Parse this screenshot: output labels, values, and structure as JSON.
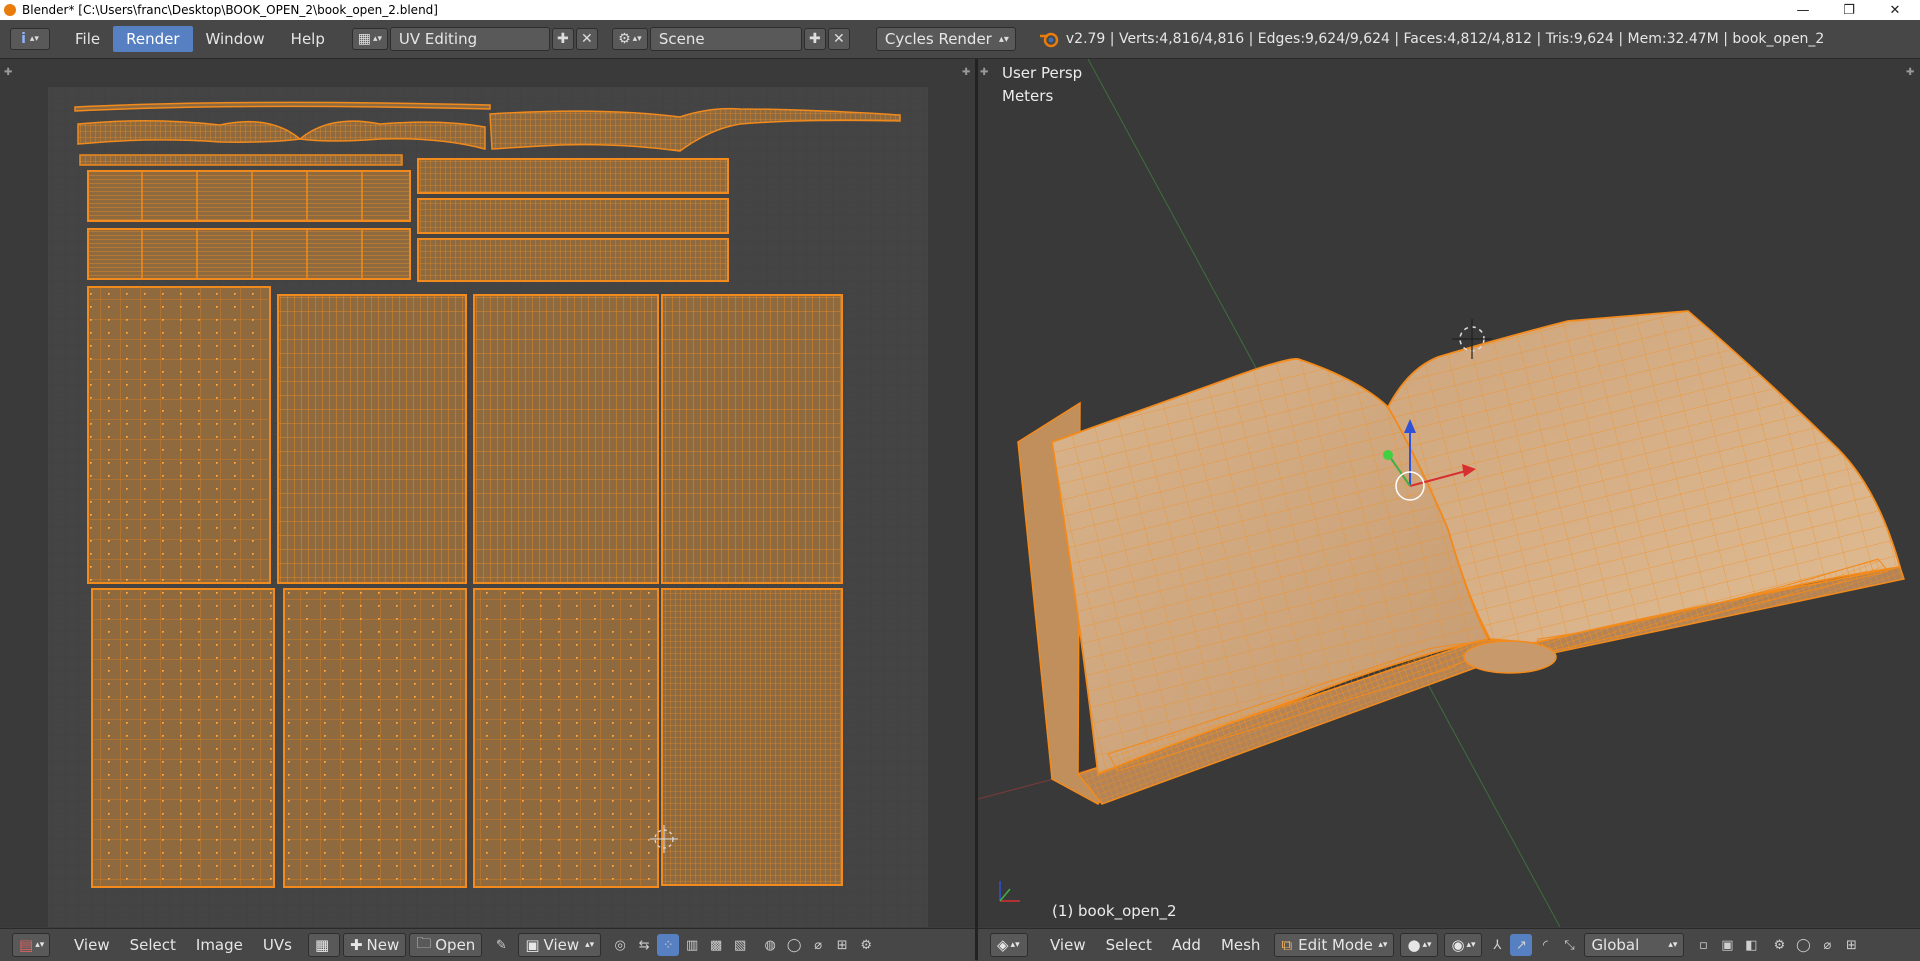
{
  "titlebar": {
    "title": "Blender* [C:\\Users\\franc\\Desktop\\BOOK_OPEN_2\\book_open_2.blend]",
    "minimize": "—",
    "maximize": "❐",
    "close": "✕"
  },
  "header": {
    "info_icon": "i",
    "menus": [
      "File",
      "Render",
      "Window",
      "Help"
    ],
    "active_menu": "Render",
    "layout": "UV Editing",
    "scene": "Scene",
    "engine": "Cycles Render",
    "stats": "v2.79 | Verts:4,816/4,816 | Edges:9,624/9,624 | Faces:4,812/4,812 | Tris:9,624 | Mem:32.47M | book_open_2"
  },
  "viewport": {
    "view_name": "User Persp",
    "units": "Meters",
    "object_label": "(1) book_open_2"
  },
  "uv_footer": {
    "menus": [
      "View",
      "Select",
      "Image",
      "UVs"
    ],
    "new_label": "New",
    "open_label": "Open",
    "view_label": "View"
  },
  "vp_footer": {
    "menus": [
      "View",
      "Select",
      "Add",
      "Mesh"
    ],
    "mode": "Edit Mode",
    "orientation": "Global"
  },
  "colors": {
    "accent_orange": "#f28a1c",
    "face_orange": "#8f6a3e",
    "active_blue": "#5680c2"
  }
}
